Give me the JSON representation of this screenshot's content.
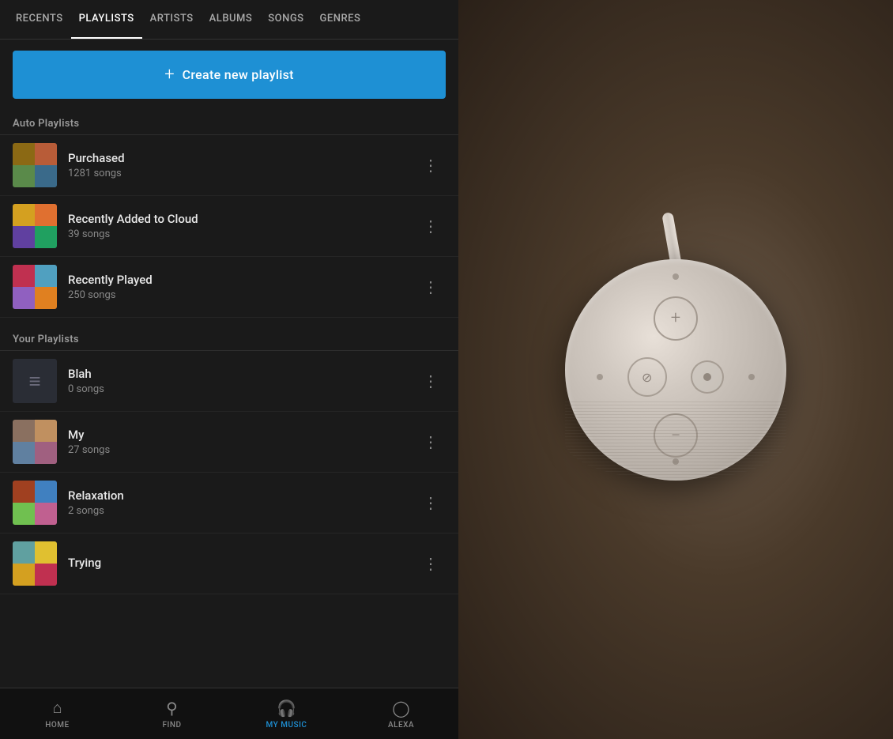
{
  "nav": {
    "items": [
      {
        "id": "recents",
        "label": "RECENTS",
        "active": false
      },
      {
        "id": "playlists",
        "label": "PLAYLISTS",
        "active": true
      },
      {
        "id": "artists",
        "label": "ARTISTS",
        "active": false
      },
      {
        "id": "albums",
        "label": "ALBUMS",
        "active": false
      },
      {
        "id": "songs",
        "label": "SONGS",
        "active": false
      },
      {
        "id": "genres",
        "label": "GENRES",
        "active": false
      }
    ]
  },
  "create_playlist_btn": {
    "plus": "+",
    "label": "Create new playlist"
  },
  "auto_playlists": {
    "section_label": "Auto Playlists",
    "items": [
      {
        "id": "purchased",
        "name": "Purchased",
        "count": "1281 songs"
      },
      {
        "id": "recently-added",
        "name": "Recently Added to Cloud",
        "count": "39 songs"
      },
      {
        "id": "recently-played",
        "name": "Recently Played",
        "count": "250 songs"
      }
    ]
  },
  "your_playlists": {
    "section_label": "Your Playlists",
    "items": [
      {
        "id": "blah",
        "name": "Blah",
        "count": "0 songs",
        "type": "dark"
      },
      {
        "id": "my",
        "name": "My",
        "count": "27 songs",
        "type": "color"
      },
      {
        "id": "relaxation",
        "name": "Relaxation",
        "count": "2 songs",
        "type": "color"
      },
      {
        "id": "trying",
        "name": "Trying",
        "count": "",
        "type": "color"
      }
    ]
  },
  "bottom_nav": {
    "items": [
      {
        "id": "home",
        "label": "HOME",
        "icon": "⌂",
        "active": false
      },
      {
        "id": "find",
        "label": "FIND",
        "icon": "⌕",
        "active": false
      },
      {
        "id": "my-music",
        "label": "MY MUSIC",
        "icon": "🎧",
        "active": true
      },
      {
        "id": "alexa",
        "label": "ALEXA",
        "icon": "◯",
        "active": false
      }
    ]
  },
  "more_btn_label": "⋮"
}
